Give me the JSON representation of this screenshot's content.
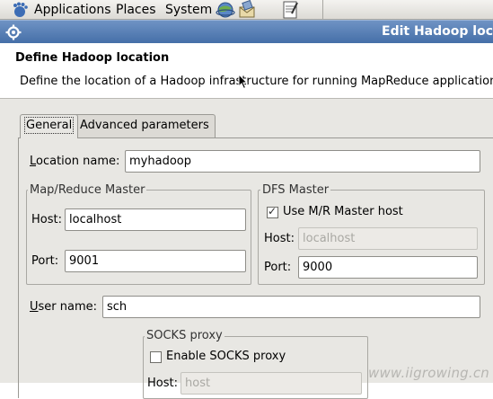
{
  "panel": {
    "menu_applications": "Applications",
    "menu_places": "Places",
    "menu_system": "System"
  },
  "window": {
    "title": "Edit Hadoop loc"
  },
  "header": {
    "title": "Define Hadoop location",
    "description": "Define the location of a Hadoop infrastructure for running MapReduce applications."
  },
  "tabs": {
    "general": "General",
    "advanced": "Advanced parameters"
  },
  "form": {
    "location_name_label_u": "L",
    "location_name_label_rest": "ocation name:",
    "location_name_value": "myhadoop",
    "mr_master": {
      "group_title": "Map/Reduce Master",
      "host_label": "Host:",
      "host_value": "localhost",
      "port_label": "Port:",
      "port_value": "9001"
    },
    "dfs_master": {
      "group_title": "DFS Master",
      "use_mr_host_label": "Use M/R Master host",
      "use_mr_host_checked": true,
      "host_label": "Host:",
      "host_value": "localhost",
      "port_label": "Port:",
      "port_value": "9000"
    },
    "user_name_label_u": "U",
    "user_name_label_rest": "ser name:",
    "user_name_value": "sch",
    "socks": {
      "group_title": "SOCKS proxy",
      "enable_label": "Enable SOCKS proxy",
      "enable_checked": false,
      "host_label": "Host:",
      "host_value": "host"
    }
  },
  "watermark": "www.iigrowing.cn"
}
